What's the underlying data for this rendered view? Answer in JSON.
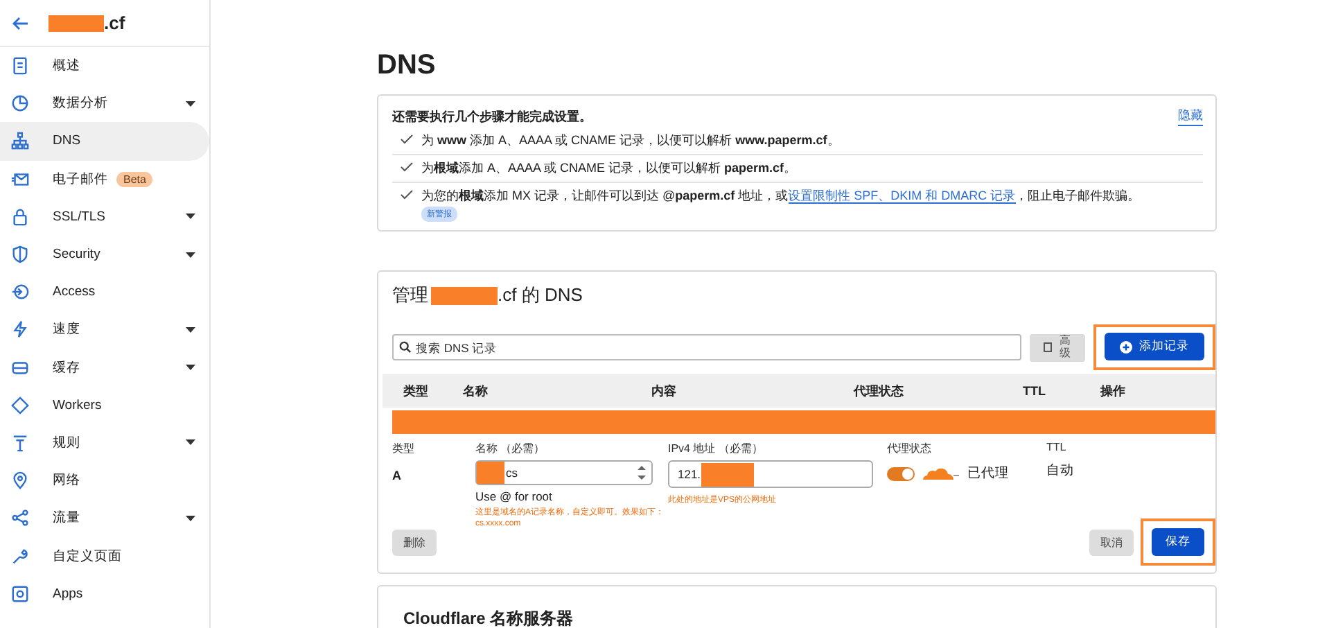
{
  "sidebar": {
    "domain": ".cf",
    "items": [
      {
        "label": "概述",
        "selected": false,
        "expandable": false
      },
      {
        "label": "数据分析",
        "selected": false,
        "expandable": true
      },
      {
        "label": "DNS",
        "selected": true,
        "expandable": false
      },
      {
        "label": "电子邮件",
        "selected": false,
        "expandable": false,
        "badge": "Beta"
      },
      {
        "label": "SSL/TLS",
        "selected": false,
        "expandable": true
      },
      {
        "label": "Security",
        "selected": false,
        "expandable": true
      },
      {
        "label": "Access",
        "selected": false,
        "expandable": false
      },
      {
        "label": "速度",
        "selected": false,
        "expandable": true
      },
      {
        "label": "缓存",
        "selected": false,
        "expandable": true
      },
      {
        "label": "Workers",
        "selected": false,
        "expandable": false
      },
      {
        "label": "规则",
        "selected": false,
        "expandable": true
      },
      {
        "label": "网络",
        "selected": false,
        "expandable": false
      },
      {
        "label": "流量",
        "selected": false,
        "expandable": true
      },
      {
        "label": "自定义页面",
        "selected": false,
        "expandable": false
      },
      {
        "label": "Apps",
        "selected": false,
        "expandable": false
      }
    ]
  },
  "page_title": "DNS",
  "setup": {
    "title": "还需要执行几个步骤才能完成设置。",
    "hide_link": "隐藏",
    "steps": [
      {
        "before": "为 **www** 添加 A、AAAA 或 CNAME 记录，以便可以解析 **www.paperm.cf**。"
      },
      {
        "before": "为**根域**添加 A、AAAA 或 CNAME 记录，以便可以解析 **paperm.cf**。"
      },
      {
        "before": "为您的**根域**添加 MX 记录，让邮件可以到达 @**paperm.cf** 地址，或",
        "link": "设置限制性 SPF、DKIM 和 DMARC 记录",
        "after": "，阻止电子邮件欺骗。",
        "badge": "新警报"
      }
    ]
  },
  "dns": {
    "title_prefix": "管理",
    "title_suffix": ".cf 的 DNS",
    "search": {
      "placeholder": "搜索 DNS 记录"
    },
    "advanced_button": "高级",
    "add_button": "添加记录",
    "columns": [
      "类型",
      "名称",
      "内容",
      "代理状态",
      "TTL",
      "操作"
    ],
    "editor": {
      "type_label": "类型",
      "type_value": "A",
      "name_label": "名称 （必需）",
      "name_value": "cs",
      "name_hint": "Use @ for root",
      "name_note": "这里是域名的A记录名称，自定义即可。效果如下：cs.xxxx.com",
      "content_label": "IPv4 地址 （必需）",
      "content_value": "121.",
      "content_note": "此处的地址是VPS的公网地址",
      "proxy_label": "代理状态",
      "proxy": {
        "on": true,
        "label": "已代理"
      },
      "ttl_label": "TTL",
      "ttl_value": "自动",
      "delete_button": "删除",
      "cancel_button": "取消",
      "save_button": "保存"
    }
  },
  "nameservers": {
    "title": "Cloudflare 名称服务器"
  }
}
